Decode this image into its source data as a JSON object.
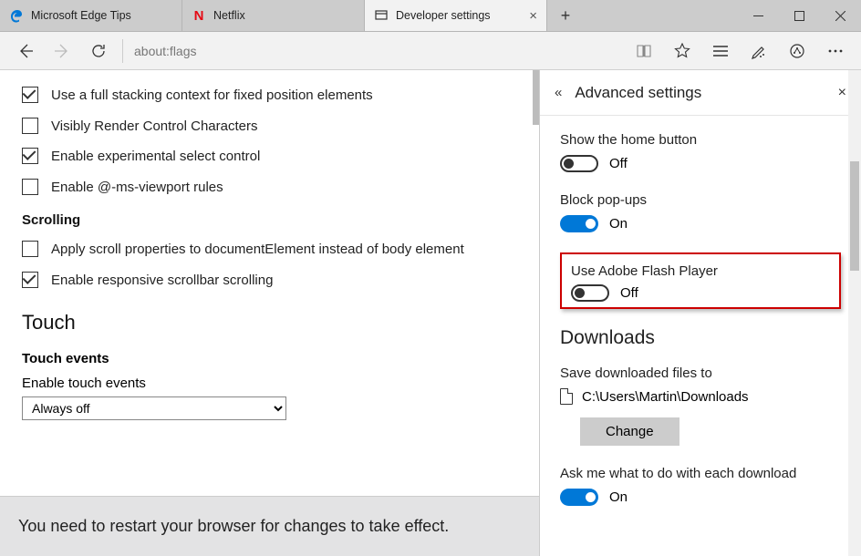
{
  "tabs": [
    {
      "label": "Microsoft Edge Tips"
    },
    {
      "label": "Netflix"
    },
    {
      "label": "Developer settings"
    }
  ],
  "address": "about:flags",
  "flags": {
    "items": [
      {
        "checked": true,
        "label": "Use a full stacking context for fixed position elements"
      },
      {
        "checked": false,
        "label": "Visibly Render Control Characters"
      },
      {
        "checked": true,
        "label": "Enable experimental select control"
      },
      {
        "checked": false,
        "label": "Enable @-ms-viewport rules"
      }
    ],
    "scrolling_header": "Scrolling",
    "scrolling": [
      {
        "checked": false,
        "label": "Apply scroll properties to documentElement instead of body element"
      },
      {
        "checked": true,
        "label": "Enable responsive scrollbar scrolling"
      }
    ],
    "touch_header": "Touch",
    "touch_events_sub": "Touch events",
    "touch_label": "Enable touch events",
    "touch_value": "Always off",
    "restart": "You need to restart your browser for changes to take effect."
  },
  "panel": {
    "title": "Advanced settings",
    "home": {
      "label": "Show the home button",
      "state": "Off",
      "on": false
    },
    "popups": {
      "label": "Block pop-ups",
      "state": "On",
      "on": true
    },
    "flash": {
      "label": "Use Adobe Flash Player",
      "state": "Off",
      "on": false
    },
    "downloads_header": "Downloads",
    "save_label": "Save downloaded files to",
    "save_path": "C:\\Users\\Martin\\Downloads",
    "change": "Change",
    "ask_label": "Ask me what to do with each download",
    "ask": {
      "state": "On",
      "on": true
    }
  }
}
